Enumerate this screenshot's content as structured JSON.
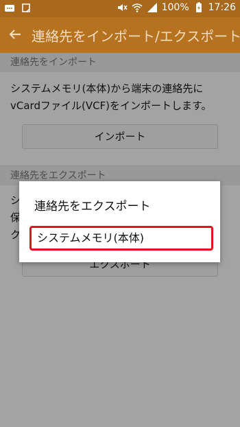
{
  "statusbar": {
    "battery": "100%",
    "time": "17:26",
    "icons": [
      "messages-icon",
      "download-icon",
      "mute-icon",
      "wifi-icon",
      "signal-icon",
      "battery-icon"
    ]
  },
  "appbar": {
    "title": "連絡先をインポート/エクスポート",
    "back_icon": "back-arrow-icon"
  },
  "import_section": {
    "header": "連絡先をインポート",
    "description_line1": "システムメモリ(本体)から端末の連絡先に",
    "description_line2": "vCardファイル(VCF)をインポートします。",
    "button": "インポート"
  },
  "export_section": {
    "header": "連絡先をエクスポート",
    "obscured_text_1": "シ",
    "obscured_text_2": "保",
    "obscured_text_3": "ク",
    "button": "エクスポート"
  },
  "dialog": {
    "title": "連絡先をエクスポート",
    "options": [
      "システムメモリ(本体)"
    ]
  },
  "colors": {
    "statusbar": "#a8691c",
    "appbar": "#b6721f",
    "highlight": "#e0141d"
  }
}
